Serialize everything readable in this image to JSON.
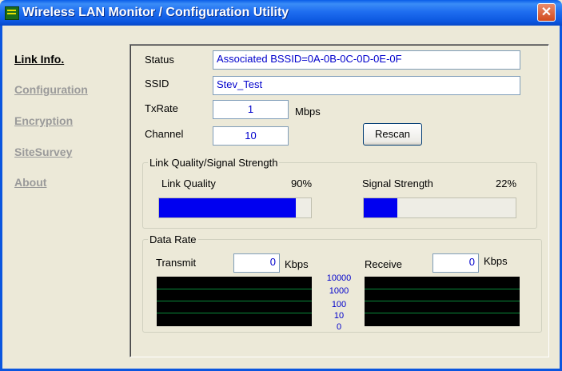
{
  "window": {
    "title": "Wireless LAN Monitor / Configuration Utility",
    "close_glyph": "✕"
  },
  "nav": {
    "items": [
      {
        "label": "Link Info.",
        "active": true
      },
      {
        "label": "Configuration",
        "active": false
      },
      {
        "label": "Encryption",
        "active": false
      },
      {
        "label": "SiteSurvey",
        "active": false
      },
      {
        "label": "About",
        "active": false
      }
    ]
  },
  "link_info": {
    "status_label": "Status",
    "status_value": "Associated BSSID=0A-0B-0C-0D-0E-0F",
    "ssid_label": "SSID",
    "ssid_value": "Stev_Test",
    "txrate_label": "TxRate",
    "txrate_value": "1",
    "txrate_unit": "Mbps",
    "channel_label": "Channel",
    "channel_value": "10",
    "rescan_label": "Rescan"
  },
  "quality": {
    "group_label": "Link Quality/Signal Strength",
    "link_quality_label": "Link Quality",
    "link_quality_value": "90%",
    "link_quality_level": 0.9,
    "signal_strength_label": "Signal Strength",
    "signal_strength_value": "22%",
    "signal_strength_level": 0.22,
    "bar_color": "#0000f0"
  },
  "data_rate": {
    "group_label": "Data Rate",
    "transmit_label": "Transmit",
    "transmit_value": "0",
    "transmit_unit": "Kbps",
    "receive_label": "Receive",
    "receive_value": "0",
    "receive_unit": "Kbps",
    "scale_labels": [
      "10000",
      "1000",
      "100",
      "10",
      "0"
    ],
    "graph_bg": "#000000",
    "grid_color": "#0a8a3a"
  }
}
